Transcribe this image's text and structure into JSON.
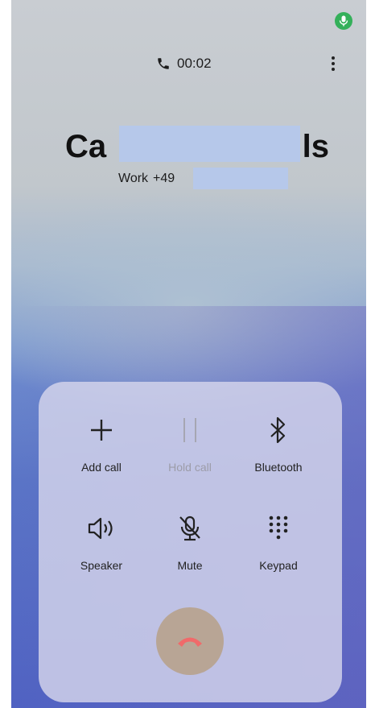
{
  "status": {
    "mic_indicator_color": "#34b05a",
    "mic_icon": "microphone-icon"
  },
  "call": {
    "duration": "00:02",
    "caller_name_start": "Ca",
    "caller_name_end": "ls",
    "number_type": "Work",
    "number_prefix": "+49"
  },
  "controls": [
    {
      "label": "Add call",
      "icon": "plus-icon"
    },
    {
      "label": "Hold call",
      "icon": "pause-icon",
      "disabled": true
    },
    {
      "label": "Bluetooth",
      "icon": "bluetooth-icon"
    },
    {
      "label": "Speaker",
      "icon": "speaker-icon"
    },
    {
      "label": "Mute",
      "icon": "mic-off-icon"
    },
    {
      "label": "Keypad",
      "icon": "keypad-icon"
    }
  ],
  "end_call": {
    "icon": "phone-hangup-icon",
    "color": "#b8a595"
  }
}
